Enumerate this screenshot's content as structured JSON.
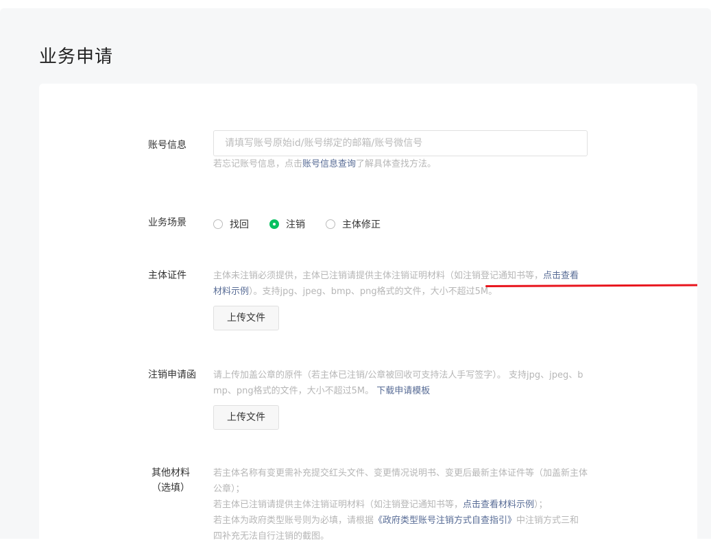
{
  "page": {
    "title": "业务申请"
  },
  "account": {
    "label": "账号信息",
    "placeholder": "请填写账号原始id/账号绑定的邮箱/账号微信号",
    "tip_prefix": "若忘记账号信息，点击",
    "tip_link": "账号信息查询",
    "tip_suffix": "了解具体查找方法。"
  },
  "scene": {
    "label": "业务场景",
    "options": [
      {
        "label": "找回",
        "checked": false
      },
      {
        "label": "注销",
        "checked": true
      },
      {
        "label": "主体修正",
        "checked": false
      }
    ]
  },
  "certificate": {
    "label": "主体证件",
    "tip_a": "主体未注销必须提供，",
    "tip_b": "主体已注销请提供主体注销证明材料（如注销登记通知书等，",
    "tip_link": "点击查看材料示例",
    "tip_c": "）。支持jpg、jpeg、bmp、png格式的文件，大小不超过5M。",
    "upload_label": "上传文件",
    "annotation_color": "#e8141c"
  },
  "cancel_letter": {
    "label": "注销申请函",
    "tip_a": "请上传加盖公章的原件（若主体已注销/公章被回收可支持法人手写签字）。 支持jpg、jpeg、bmp、png格式的文件，大小不超过5M。 ",
    "tip_link": "下载申请模板",
    "upload_label": "上传文件"
  },
  "other": {
    "label": "其他材料（选填）",
    "line1": "若主体名称有变更需补充提交红头文件、变更情况说明书、变更后最新主体证件等（加盖新主体公章）；",
    "line2_a": "若主体已注销请提供主体注销证明材料（如注销登记通知书等，",
    "line2_link": "点击查看材料示例",
    "line2_b": "）；",
    "line3_a": "若主体为政府类型账号则为必填，请根据",
    "line3_link": "《政府类型账号注销方式自查指引》",
    "line3_b": "中注销方式三和四补充无法自行注销的截图。"
  },
  "colors": {
    "accent": "#07c160",
    "link": "#576b95"
  }
}
